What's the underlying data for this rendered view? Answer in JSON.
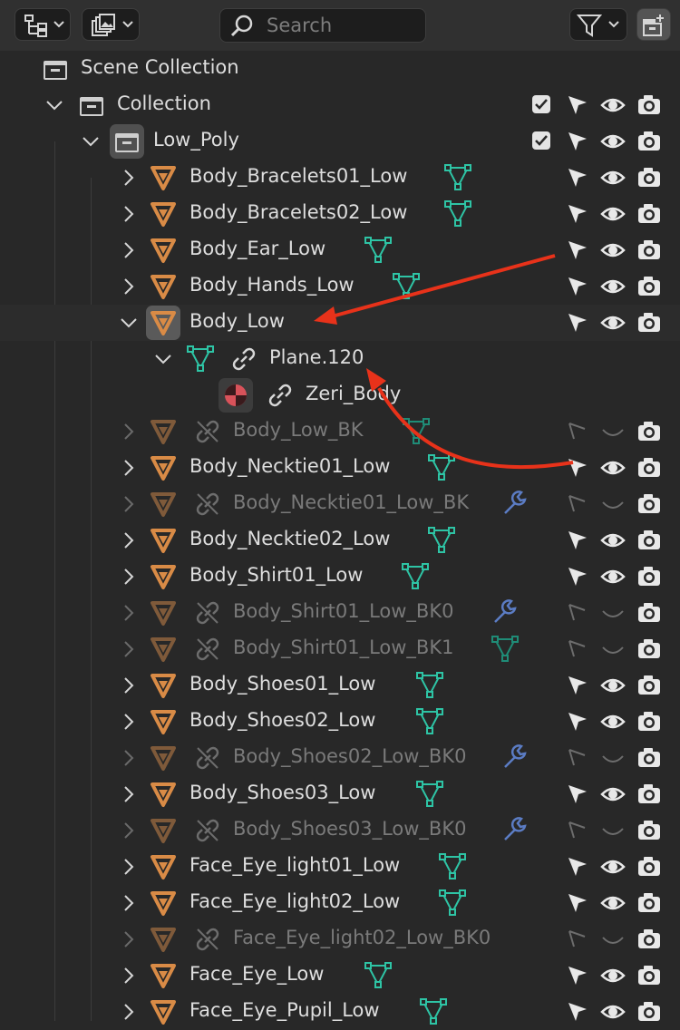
{
  "header": {
    "search_placeholder": "Search",
    "display_mode_icon": "outliner-view-icon",
    "filter_icon": "funnel-icon",
    "new_collection_icon": "new-collection-icon"
  },
  "tree": {
    "scene_collection": "Scene Collection",
    "collection": "Collection",
    "low_poly": "Low_Poly",
    "plane": "Plane.120",
    "material": "Zeri_Body",
    "items": [
      {
        "label": "Body_Bracelets01_Low",
        "active": true,
        "data_icon": "mesh-data-icon"
      },
      {
        "label": "Body_Bracelets02_Low",
        "active": true,
        "data_icon": "mesh-data-icon"
      },
      {
        "label": "Body_Ear_Low",
        "active": true,
        "data_icon": "mesh-data-icon"
      },
      {
        "label": "Body_Hands_Low",
        "active": true,
        "data_icon": "mesh-data-icon"
      },
      {
        "label": "Body_Low",
        "active": true,
        "data_icon": "",
        "expanded": true,
        "selected": true
      },
      {
        "label": "Body_Low_BK",
        "active": false,
        "data_icon": "mesh-data-icon"
      },
      {
        "label": "Body_Necktie01_Low",
        "active": true,
        "data_icon": "mesh-data-icon"
      },
      {
        "label": "Body_Necktie01_Low_BK",
        "active": false,
        "data_icon": "wrench-icon"
      },
      {
        "label": "Body_Necktie02_Low",
        "active": true,
        "data_icon": "mesh-data-icon"
      },
      {
        "label": "Body_Shirt01_Low",
        "active": true,
        "data_icon": "mesh-data-icon"
      },
      {
        "label": "Body_Shirt01_Low_BK0",
        "active": false,
        "data_icon": "wrench-icon"
      },
      {
        "label": "Body_Shirt01_Low_BK1",
        "active": false,
        "data_icon": "mesh-data-icon"
      },
      {
        "label": "Body_Shoes01_Low",
        "active": true,
        "data_icon": "mesh-data-icon"
      },
      {
        "label": "Body_Shoes02_Low",
        "active": true,
        "data_icon": "mesh-data-icon"
      },
      {
        "label": "Body_Shoes02_Low_BK0",
        "active": false,
        "data_icon": "wrench-icon"
      },
      {
        "label": "Body_Shoes03_Low",
        "active": true,
        "data_icon": "mesh-data-icon"
      },
      {
        "label": "Body_Shoes03_Low_BK0",
        "active": false,
        "data_icon": "wrench-icon"
      },
      {
        "label": "Face_Eye_light01_Low",
        "active": true,
        "data_icon": "mesh-data-icon"
      },
      {
        "label": "Face_Eye_light02_Low",
        "active": true,
        "data_icon": "mesh-data-icon"
      },
      {
        "label": "Face_Eye_light02_Low_BK0",
        "active": false,
        "data_icon": ""
      },
      {
        "label": "Face_Eye_Low",
        "active": true,
        "data_icon": "mesh-data-icon"
      },
      {
        "label": "Face_Eye_Pupil_Low",
        "active": true,
        "data_icon": "mesh-data-icon"
      }
    ]
  },
  "colors": {
    "background": "#282828",
    "object_icon": "#d98b46",
    "mesh_data": "#2ec4a5",
    "wrench": "#5b7cc4",
    "annotation_arrow": "#e8321a"
  }
}
